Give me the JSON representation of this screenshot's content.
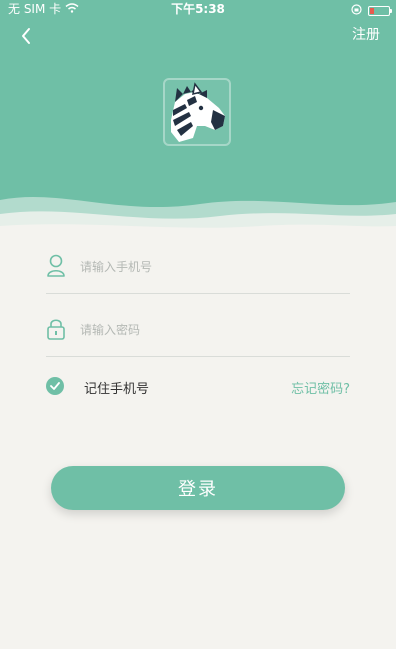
{
  "status_bar": {
    "carrier": "无 SIM 卡",
    "time": "下午5:38"
  },
  "header": {
    "back_icon": "chevron-left-icon",
    "register_label": "注册",
    "logo_icon": "zebra-logo-icon"
  },
  "form": {
    "phone": {
      "placeholder": "请输入手机号",
      "value": "",
      "icon": "user-icon"
    },
    "password": {
      "placeholder": "请输入密码",
      "value": "",
      "icon": "lock-icon"
    },
    "remember": {
      "label": "记住手机号",
      "checked": true
    },
    "forgot_label": "忘记密码?",
    "login_label": "登录"
  },
  "colors": {
    "brand": "#6fbfa6",
    "background": "#f4f3ef",
    "battery_low": "#e85a4f"
  }
}
